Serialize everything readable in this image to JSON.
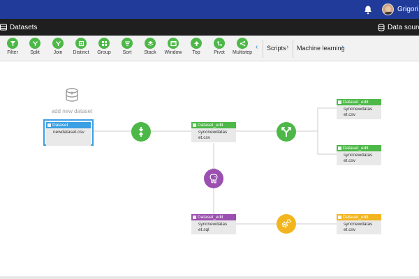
{
  "header": {
    "user_name": "Grigori P",
    "notification_icon": "bell-icon",
    "avatar": "user-avatar"
  },
  "subheader": {
    "left_title": "Datasets",
    "right_title": "Data source"
  },
  "toolbar": {
    "tools": [
      {
        "label": "Filter",
        "icon": "filter-icon"
      },
      {
        "label": "Split",
        "icon": "split-icon"
      },
      {
        "label": "Join",
        "icon": "join-icon"
      },
      {
        "label": "Distinct",
        "icon": "distinct-icon"
      },
      {
        "label": "Group",
        "icon": "group-icon"
      },
      {
        "label": "Sort",
        "icon": "sort-icon"
      },
      {
        "label": "Stack",
        "icon": "stack-icon"
      },
      {
        "label": "Window",
        "icon": "window-icon"
      },
      {
        "label": "Top",
        "icon": "top-icon"
      },
      {
        "label": "Pivot",
        "icon": "pivot-icon"
      },
      {
        "label": "Multistep",
        "icon": "multistep-icon"
      }
    ],
    "scripts_label": "Scripts",
    "ml_label": "Machine learning"
  },
  "canvas": {
    "add_dataset_label": "add new dataset",
    "nodes": {
      "source": {
        "type": "Dataset",
        "file": "newdataset.csv"
      },
      "edit1": {
        "type": "Dataset_edit",
        "line1": "syncnewdatas",
        "line2": "et.csv"
      },
      "edit_sql": {
        "type": "Dataset_edit",
        "line1": "syncnewdatas",
        "line2": "et.sql"
      },
      "out_top": {
        "type": "Dataset_edit",
        "line1": "syncnewdatas",
        "line2": "et.csv"
      },
      "out_mid": {
        "type": "Dataset_edit",
        "line1": "syncnewdatas",
        "line2": "et.csv"
      },
      "out_bottom": {
        "type": "Dataset_edit",
        "line1": "syncnewdatas",
        "line2": "et.csv"
      }
    }
  },
  "colors": {
    "top_bar": "#203b9a",
    "green": "#4db848",
    "purple": "#9b4fb0",
    "yellow": "#f2b51f",
    "blue": "#3aa0e3"
  }
}
